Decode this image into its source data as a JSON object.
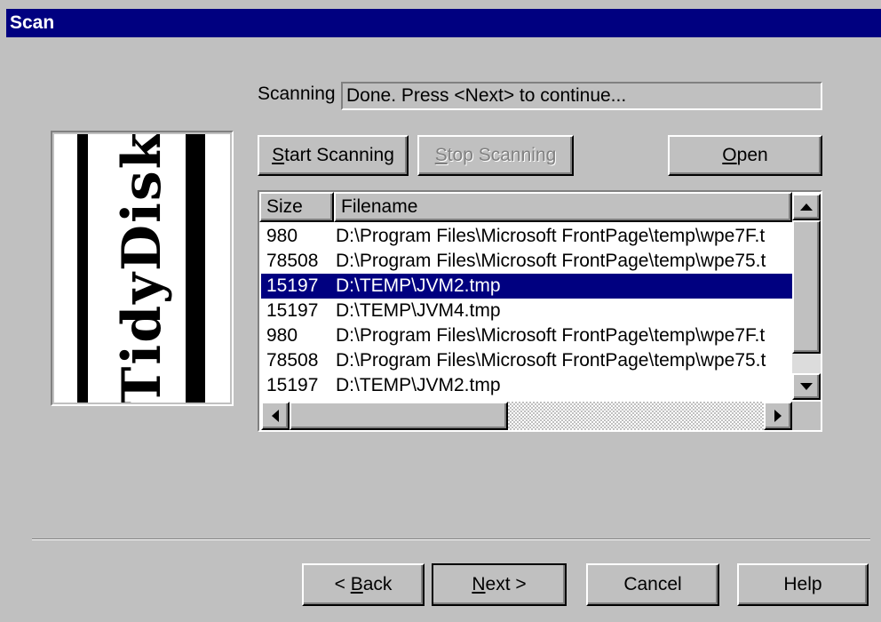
{
  "window": {
    "title": "Scan"
  },
  "logo": {
    "text": "TidyDisk"
  },
  "scan": {
    "label": "Scanning",
    "status": "Done.  Press <Next> to continue..."
  },
  "buttons": {
    "start_prefix": "",
    "start_mnemonic": "S",
    "start_rest": "tart Scanning",
    "stop_prefix": "",
    "stop_mnemonic": "S",
    "stop_rest": "top Scanning",
    "open_prefix": "",
    "open_mnemonic": "O",
    "open_rest": "pen",
    "back_prefix": "< ",
    "back_mnemonic": "B",
    "back_rest": "ack",
    "next_prefix": "",
    "next_mnemonic": "N",
    "next_rest": "ext >",
    "cancel": "Cancel",
    "help": "Help"
  },
  "list": {
    "columns": [
      "Size",
      "Filename"
    ],
    "rows": [
      {
        "size": "980",
        "filename": "D:\\Program Files\\Microsoft FrontPage\\temp\\wpe7F.t"
      },
      {
        "size": "78508",
        "filename": "D:\\Program Files\\Microsoft FrontPage\\temp\\wpe75.t"
      },
      {
        "size": "15197",
        "filename": "D:\\TEMP\\JVM2.tmp"
      },
      {
        "size": "15197",
        "filename": "D:\\TEMP\\JVM4.tmp"
      },
      {
        "size": "980",
        "filename": "D:\\Program Files\\Microsoft FrontPage\\temp\\wpe7F.t"
      },
      {
        "size": "78508",
        "filename": "D:\\Program Files\\Microsoft FrontPage\\temp\\wpe75.t"
      },
      {
        "size": "15197",
        "filename": "D:\\TEMP\\JVM2.tmp"
      }
    ],
    "selected_index": 2
  },
  "icons": {
    "scroll_up": "up-arrow-icon",
    "scroll_down": "down-arrow-icon",
    "scroll_left": "left-arrow-icon",
    "scroll_right": "right-arrow-icon"
  },
  "colors": {
    "titlebar": "#000080",
    "selection": "#000080",
    "face": "#c0c0c0"
  }
}
